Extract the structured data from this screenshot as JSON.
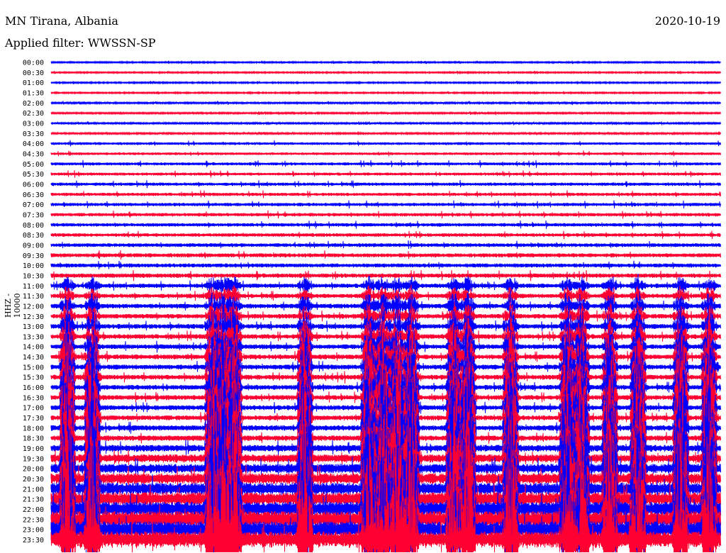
{
  "header": {
    "station": "MN Tirana, Albania",
    "filter": "Applied filter: WWSSN-SP",
    "date": "2020-10-19"
  },
  "chart_data": {
    "type": "line",
    "title": "MN Tirana, Albania",
    "ylabel": "HHZ - 10000",
    "colors": [
      "#0000ff",
      "#ff0033"
    ],
    "row_labels": [
      "00:00",
      "00:30",
      "01:00",
      "01:30",
      "02:00",
      "02:30",
      "03:00",
      "03:30",
      "04:00",
      "04:30",
      "05:00",
      "05:30",
      "06:00",
      "06:30",
      "07:00",
      "07:30",
      "08:00",
      "08:30",
      "09:00",
      "09:30",
      "10:00",
      "10:30",
      "11:00",
      "11:30",
      "12:00",
      "12:30",
      "13:00",
      "13:30",
      "14:00",
      "14:30",
      "15:00",
      "15:30",
      "16:00",
      "16:30",
      "17:00",
      "17:30",
      "18:00",
      "18:30",
      "19:00",
      "19:30",
      "20:00",
      "20:30",
      "21:00",
      "21:30",
      "22:00",
      "22:30",
      "23:00",
      "23:30"
    ],
    "noise_level": [
      1,
      1,
      1,
      1,
      1.2,
      1.2,
      1.2,
      1.2,
      2,
      2,
      2.2,
      2.2,
      2.4,
      2.4,
      2.5,
      2.5,
      2.6,
      2.6,
      2.8,
      3,
      3,
      3.2,
      3.2,
      3.2,
      3.4,
      3.4,
      3.5,
      3.5,
      3.5,
      3.5,
      3.6,
      3.6,
      3.6,
      3.6,
      3.6,
      3.6,
      4,
      4,
      5,
      6,
      7,
      8,
      9,
      10,
      11,
      12,
      12,
      12
    ],
    "burst_level": [
      0,
      0,
      0,
      0,
      0,
      0,
      0,
      0,
      0,
      0,
      0,
      0,
      0,
      0,
      0,
      0,
      0,
      0,
      0,
      0,
      0,
      0,
      0.1,
      0.1,
      0.15,
      0.15,
      0.2,
      0.2,
      0.25,
      0.3,
      0.35,
      0.4,
      0.45,
      0.5,
      0.55,
      0.6,
      0.65,
      0.7,
      0.75,
      0.8,
      0.85,
      0.9,
      0.9,
      0.95,
      1,
      1,
      1,
      1
    ]
  }
}
